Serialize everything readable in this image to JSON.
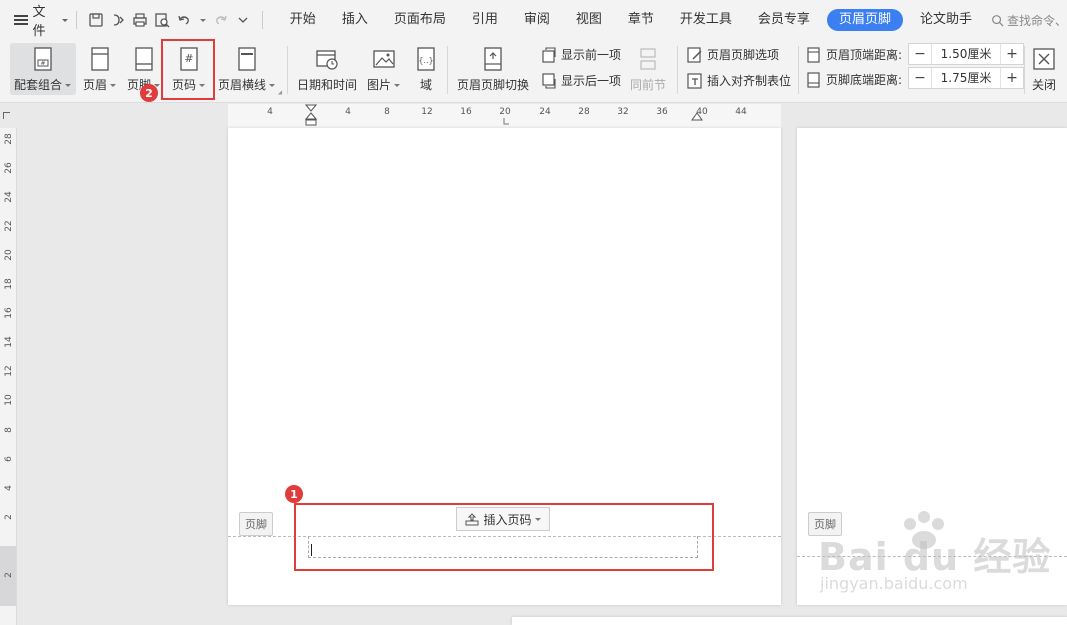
{
  "menubar": {
    "file_label": "文件",
    "tabs": [
      "开始",
      "插入",
      "页面布局",
      "引用",
      "审阅",
      "视图",
      "章节",
      "开发工具",
      "会员专享"
    ],
    "active_tab": "页眉页脚",
    "extra_tab": "论文助手",
    "search_placeholder": "查找命令、"
  },
  "ribbon": {
    "btn_combo": "配套组合",
    "btn_header": "页眉",
    "btn_footer": "页脚",
    "btn_page_number": "页码",
    "btn_header_line": "页眉横线",
    "btn_datetime": "日期和时间",
    "btn_picture": "图片",
    "btn_field": "域",
    "btn_switch": "页眉页脚切换",
    "show_prev": "显示前一项",
    "show_next": "显示后一项",
    "same_as_prev": "同前节",
    "hf_options": "页眉页脚选项",
    "insert_tab": "插入对齐制表位",
    "header_top_label": "页眉顶端距离:",
    "header_top_value": "1.50厘米",
    "footer_bottom_label": "页脚底端距离:",
    "footer_bottom_value": "1.75厘米",
    "close": "关闭"
  },
  "ruler": {
    "h_labels": [
      "4",
      "4",
      "8",
      "12",
      "16",
      "20",
      "24",
      "28",
      "32",
      "36",
      "40",
      "44"
    ],
    "v_labels": [
      "28",
      "26",
      "24",
      "22",
      "20",
      "18",
      "16",
      "14",
      "12",
      "10",
      "8",
      "6",
      "4",
      "2",
      "2"
    ]
  },
  "document": {
    "footer_tag": "页脚",
    "footer_tag2": "页脚",
    "insert_page_number": "插入页码"
  },
  "annotations": {
    "badge1": "1",
    "badge2": "2"
  },
  "watermark": {
    "main": "Bai du 经验",
    "sub": "jingyan.baidu.com"
  }
}
